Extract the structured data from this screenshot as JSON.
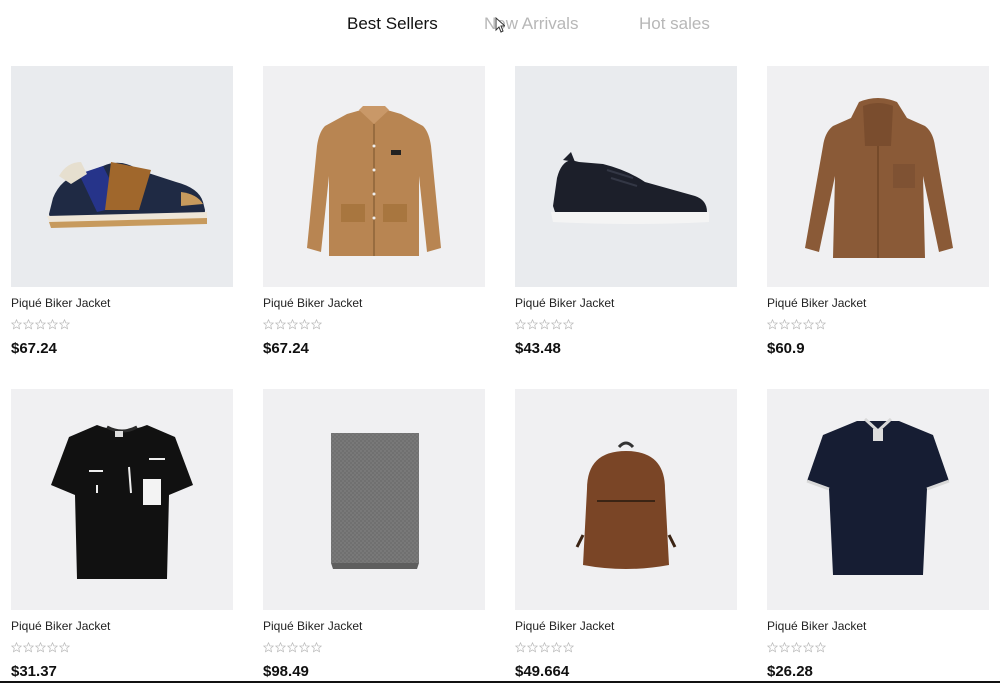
{
  "tabs": [
    {
      "label": "Best Sellers",
      "active": true
    },
    {
      "label": "New Arrivals",
      "active": false
    },
    {
      "label": "Hot sales",
      "active": false
    }
  ],
  "products": [
    {
      "name": "Piqué Biker Jacket",
      "price": "$67.24",
      "rating": 0,
      "image": "sneaker-blue-icon"
    },
    {
      "name": "Piqué Biker Jacket",
      "price": "$67.24",
      "rating": 0,
      "image": "tan-jacket-icon"
    },
    {
      "name": "Piqué Biker Jacket",
      "price": "$43.48",
      "rating": 0,
      "image": "black-sneaker-icon"
    },
    {
      "name": "Piqué Biker Jacket",
      "price": "$60.9",
      "rating": 0,
      "image": "brown-hoodie-icon"
    },
    {
      "name": "Piqué Biker Jacket",
      "price": "$31.37",
      "rating": 0,
      "image": "black-tshirt-icon"
    },
    {
      "name": "Piqué Biker Jacket",
      "price": "$98.49",
      "rating": 0,
      "image": "grey-scarf-icon"
    },
    {
      "name": "Piqué Biker Jacket",
      "price": "$49.664",
      "rating": 0,
      "image": "brown-backpack-icon"
    },
    {
      "name": "Piqué Biker Jacket",
      "price": "$26.28",
      "rating": 0,
      "image": "navy-polo-icon"
    }
  ],
  "colors": {
    "tab_active": "#111111",
    "tab_inactive": "#b7b7b7",
    "thumb_bg": "#f0f0f2",
    "star_outline": "#bbbbbb"
  }
}
